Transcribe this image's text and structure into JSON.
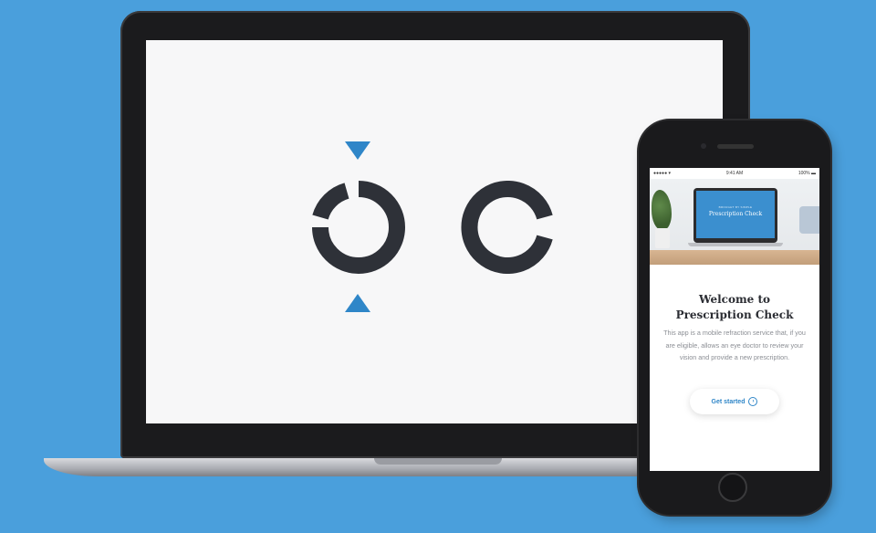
{
  "laptop": {
    "marker_color": "#2f86c8",
    "ring_color": "#2e3138",
    "icons": [
      "arrow-down-icon",
      "arrow-up-icon",
      "landolt-ring-icon",
      "c-ring-icon"
    ]
  },
  "phone": {
    "status": {
      "signal": "●●●●● ▾",
      "time": "9:41 AM",
      "battery": "100% ▬"
    },
    "hero": {
      "small_text": "BROUGHT BY SIMPLE",
      "title": "Prescription Check"
    },
    "welcome": {
      "title_line1": "Welcome to",
      "title_line2": "Prescription Check",
      "body": "This app is a mobile refraction service that, if you are eligible, allows an eye doctor to review your vision and provide a new prescription."
    },
    "cta": {
      "label": "Get started",
      "icon": "arrow-circle-icon",
      "icon_glyph": "›"
    }
  }
}
